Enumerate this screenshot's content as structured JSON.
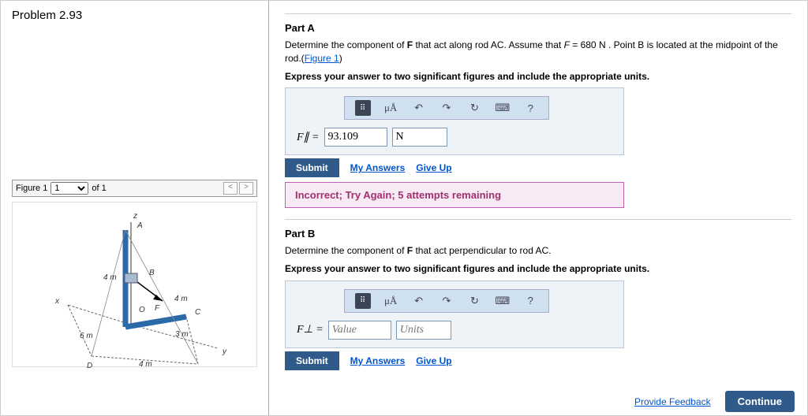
{
  "left": {
    "problem_title": "Problem 2.93",
    "figure_label": "Figure 1",
    "figure_of": "of 1",
    "nav_prev": "<",
    "nav_next": ">",
    "diagram": {
      "labels": {
        "A": "A",
        "B": "B",
        "C": "C",
        "D": "D",
        "O": "O",
        "F": "F",
        "x": "x",
        "y": "y",
        "z": "z"
      },
      "dims": {
        "d1": "4 m",
        "d2": "4 m",
        "d3": "3 m",
        "d4": "4 m",
        "d5": "6 m"
      }
    }
  },
  "right": {
    "partA": {
      "title": "Part A",
      "desc_1": "Determine the component of ",
      "desc_F": "F",
      "desc_2": " that act along rod AC. Assume that ",
      "desc_eqF": "F",
      "desc_eqVal": " = 680 ",
      "desc_eqU": "N",
      "desc_3": " . Point B is located at the midpoint of the rod.(",
      "fig_link": "Figure 1",
      "desc_4": ")",
      "instr": "Express your answer to two significant figures and include the appropriate units.",
      "prefix": "F∥ =",
      "value": "93.109",
      "units": "N",
      "feedback": "Incorrect; Try Again; 5 attempts remaining"
    },
    "partB": {
      "title": "Part B",
      "desc_1": "Determine the component of ",
      "desc_F": "F",
      "desc_2": " that act perpendicular to rod AC.",
      "instr": "Express your answer to two significant figures and include the appropriate units.",
      "prefix": "F⊥ =",
      "value_ph": "Value",
      "units_ph": "Units"
    },
    "toolbar": {
      "templates": "⠿",
      "ua": "μÅ",
      "undo": "↶",
      "redo": "↷",
      "reset": "↻",
      "keyboard": "⌨",
      "help": "?"
    },
    "buttons": {
      "submit": "Submit",
      "my_answers": "My Answers",
      "give_up": "Give Up",
      "provide_feedback": "Provide Feedback",
      "continue": "Continue"
    }
  }
}
